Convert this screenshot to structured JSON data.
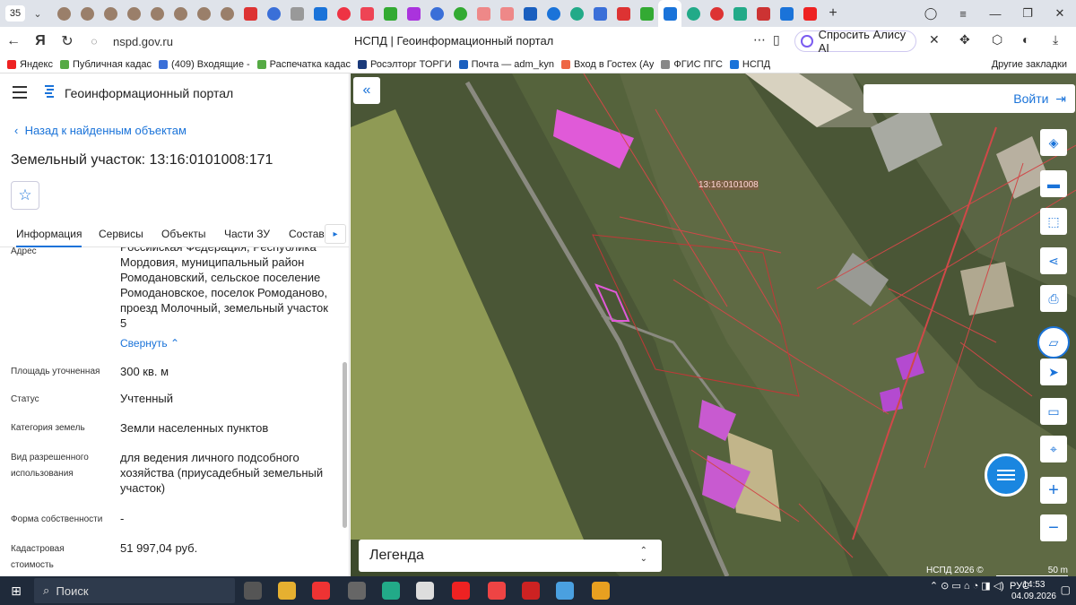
{
  "browser": {
    "tab_count": "35",
    "url": "nspd.gov.ru",
    "page_title": "НСПД | Геоинформационный портал",
    "alice_label": "Спросить Алису AI",
    "bookmarks": [
      "Яндекс",
      "Публичная кадас",
      "(409) Входящие -",
      "Распечатка кадас",
      "Росэлторг ТОРГИ",
      "Почта — adm_kyn",
      "Вход в Гостех (Ау",
      "ФГИС ПГС",
      "НСПД"
    ],
    "other_bookmarks": "Другие закладки"
  },
  "panel": {
    "portal_title": "Геоинформационный портал",
    "back_label": "Назад к найденным объектам",
    "object_title": "Земельный участок: 13:16:0101008:171",
    "tabs": [
      "Информация",
      "Сервисы",
      "Объекты",
      "Части ЗУ",
      "Состав"
    ],
    "fields": {
      "address_label": "Адрес",
      "address_value": "Российская Федерация, Республика Мордовия, муниципальный район Ромодановский, сельское поселение Ромодановское, поселок Ромоданово, проезд Молочный, земельный участок 5",
      "collapse": "Свернуть",
      "area_label": "Площадь уточненная",
      "area_value": "300 кв. м",
      "status_label": "Статус",
      "status_value": "Учтенный",
      "category_label": "Категория земель",
      "category_value": "Земли населенных пунктов",
      "use_label": "Вид разрешенного использования",
      "use_value": "для ведения личного подсобного хозяйства (приусадебный земельный участок)",
      "ownership_label": "Форма собственности",
      "ownership_value": "-",
      "cost_label": "Кадастровая стоимость",
      "cost_value": "51 997,04 руб."
    }
  },
  "map": {
    "login": "Войти",
    "legend": "Легенда",
    "cad_label": "13:16:0101008",
    "copyright": "НСПД 2026 ©",
    "scale": "50 m"
  },
  "taskbar": {
    "search": "Поиск",
    "lang": "РУС",
    "time": "14:53",
    "date": "04.09.2026"
  }
}
